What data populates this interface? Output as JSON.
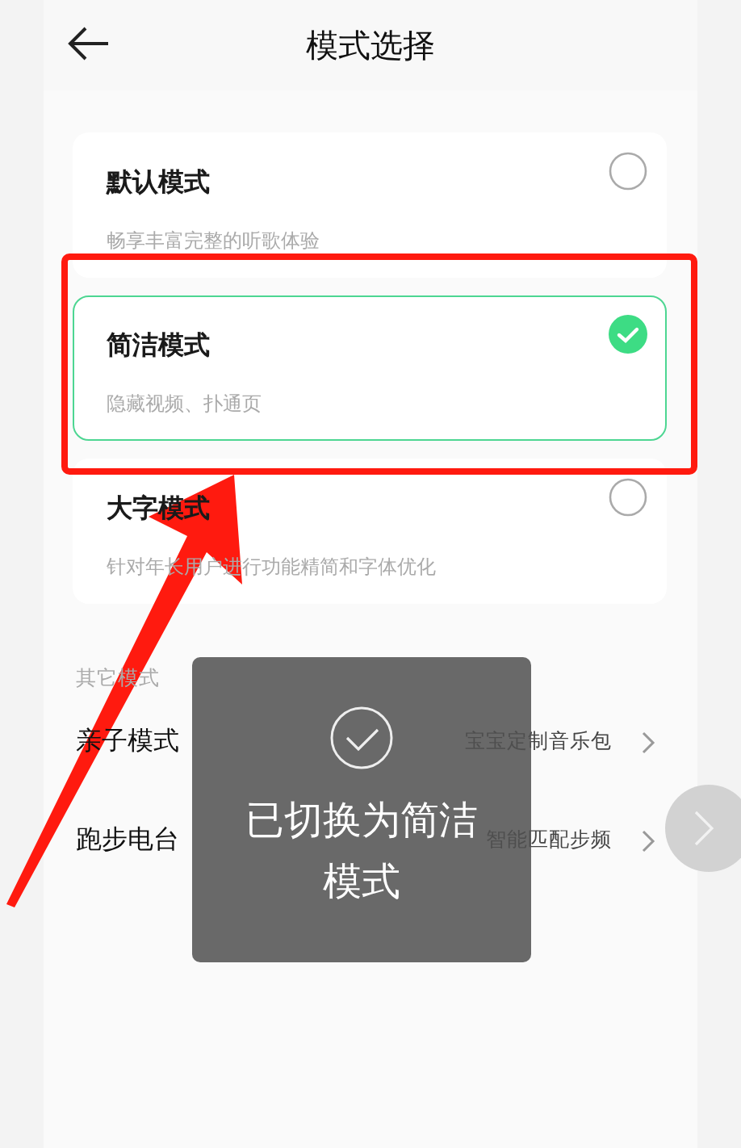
{
  "header": {
    "title": "模式选择"
  },
  "modes": [
    {
      "title": "默认模式",
      "subtitle": "畅享丰富完整的听歌体验",
      "selected": false
    },
    {
      "title": "简洁模式",
      "subtitle": "隐藏视频、扑通页",
      "selected": true
    },
    {
      "title": "大字模式",
      "subtitle": "针对年长用户进行功能精简和字体优化",
      "selected": false
    }
  ],
  "other_section": {
    "label": "其它模式",
    "items": [
      {
        "title": "亲子模式",
        "detail": "宝宝定制音乐包"
      },
      {
        "title": "跑步电台",
        "detail": "智能匹配步频"
      }
    ]
  },
  "toast": {
    "message": "已切换为简洁模式"
  }
}
